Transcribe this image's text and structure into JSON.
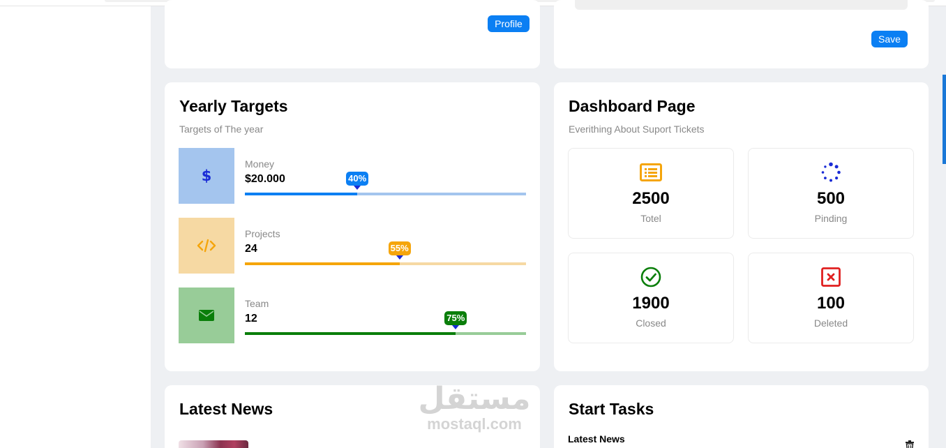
{
  "profile_card": {
    "button_label": "Profile"
  },
  "settings_card": {
    "save_label": "Save"
  },
  "yearly_targets": {
    "title": "Yearly Targets",
    "subtitle": "Targets of The year",
    "items": [
      {
        "label": "Money",
        "value": "$20.000",
        "percent": 40,
        "percent_label": "40%",
        "icon": "dollar-icon",
        "color": "#0b7ff3",
        "track_color": "#a4c5ee",
        "tile_color": "#a4c5ee"
      },
      {
        "label": "Projects",
        "value": "24",
        "percent": 55,
        "percent_label": "55%",
        "icon": "code-icon",
        "color": "#f5a50b",
        "track_color": "#f6d9a3",
        "tile_color": "#f6d9a3"
      },
      {
        "label": "Team",
        "value": "12",
        "percent": 75,
        "percent_label": "75%",
        "icon": "envelope-icon",
        "color": "#0a7e0a",
        "track_color": "#98cc98",
        "tile_color": "#98cc98"
      }
    ]
  },
  "dashboard": {
    "title": "Dashboard Page",
    "subtitle": "Everithing About Suport Tickets",
    "tickets": [
      {
        "number": "2500",
        "label": "Totel",
        "icon": "list-icon",
        "color": "#f5a50b"
      },
      {
        "number": "500",
        "label": "Pinding",
        "icon": "spinner-icon",
        "color": "#1a2bd6"
      },
      {
        "number": "1900",
        "label": "Closed",
        "icon": "check-circle-icon",
        "color": "#0a7e0a"
      },
      {
        "number": "100",
        "label": "Deleted",
        "icon": "close-square-icon",
        "color": "#e02020"
      }
    ]
  },
  "latest_news": {
    "title": "Latest News"
  },
  "start_tasks": {
    "title": "Start Tasks",
    "first_task_title": "Latest News"
  },
  "watermark": {
    "arabic": "مستقل",
    "latin": "mostaql.com"
  }
}
